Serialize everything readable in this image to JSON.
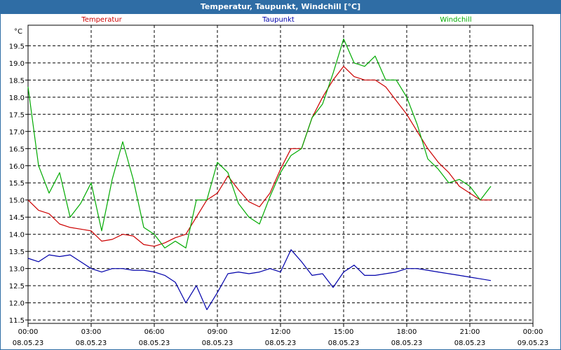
{
  "window": {
    "title": "Temperatur, Taupunkt, Windchill [°C]"
  },
  "chart_data": {
    "type": "line",
    "title": "Temperatur, Taupunkt, Windchill [°C]",
    "ylabel": "°C",
    "xlabel": "",
    "ylim": [
      11.4,
      20.1
    ],
    "y_ticks": [
      "11.5",
      "12.0",
      "12.5",
      "13.0",
      "13.5",
      "14.0",
      "14.5",
      "15.0",
      "15.5",
      "16.0",
      "16.5",
      "17.0",
      "17.5",
      "18.0",
      "18.5",
      "19.0",
      "19.5"
    ],
    "x_ticks": [
      {
        "time": "00:00",
        "date": "08.05.23"
      },
      {
        "time": "03:00",
        "date": "08.05.23"
      },
      {
        "time": "06:00",
        "date": "08.05.23"
      },
      {
        "time": "09:00",
        "date": "08.05.23"
      },
      {
        "time": "12:00",
        "date": "08.05.23"
      },
      {
        "time": "15:00",
        "date": "08.05.23"
      },
      {
        "time": "18:00",
        "date": "08.05.23"
      },
      {
        "time": "21:00",
        "date": "08.05.23"
      },
      {
        "time": "00:00",
        "date": "09.05.23"
      }
    ],
    "grid": true,
    "x": [
      0,
      0.5,
      1,
      1.5,
      2,
      2.5,
      3,
      3.5,
      4,
      4.5,
      5,
      5.5,
      6,
      6.5,
      7,
      7.5,
      8,
      8.5,
      9,
      9.5,
      10,
      10.5,
      11,
      11.5,
      12,
      12.5,
      13,
      13.5,
      14,
      14.5,
      15,
      15.5,
      16,
      16.5,
      17,
      17.5,
      18,
      18.5,
      19,
      19.5,
      20,
      20.5,
      21,
      21.5,
      22,
      22.5,
      23,
      23.5,
      24
    ],
    "series": [
      {
        "name": "Temperatur",
        "color": "#cc0000",
        "values": [
          15.0,
          14.7,
          14.6,
          14.3,
          14.2,
          14.15,
          14.1,
          13.8,
          13.85,
          14.0,
          13.95,
          13.7,
          13.65,
          13.75,
          13.9,
          14.0,
          14.5,
          15.0,
          15.2,
          15.7,
          15.3,
          14.95,
          14.8,
          15.2,
          15.9,
          16.5,
          16.5,
          17.4,
          18.0,
          18.5,
          18.9,
          18.6,
          18.5,
          18.5,
          18.3,
          17.9,
          17.5,
          17.0,
          16.5,
          16.1,
          15.8,
          15.4,
          15.2,
          15.0,
          15.0,
          null,
          null,
          null,
          null
        ]
      },
      {
        "name": "Taupunkt",
        "color": "#0000aa",
        "values": [
          13.3,
          13.2,
          13.4,
          13.35,
          13.4,
          13.2,
          13.0,
          12.9,
          13.0,
          13.0,
          12.95,
          12.95,
          12.9,
          12.8,
          12.6,
          12.0,
          12.5,
          11.8,
          12.3,
          12.85,
          12.9,
          12.85,
          12.9,
          13.0,
          12.9,
          13.55,
          13.2,
          12.8,
          12.85,
          12.45,
          12.9,
          13.1,
          12.8,
          12.8,
          12.85,
          12.9,
          13.0,
          13.0,
          12.95,
          12.9,
          12.85,
          12.8,
          12.75,
          12.7,
          12.65,
          null,
          null,
          null,
          null
        ]
      },
      {
        "name": "Windchill",
        "color": "#00aa00",
        "values": [
          18.3,
          16.0,
          15.2,
          15.8,
          14.5,
          14.9,
          15.5,
          14.1,
          15.6,
          16.7,
          15.6,
          14.2,
          14.0,
          13.6,
          13.8,
          13.6,
          15.0,
          15.0,
          16.1,
          15.8,
          14.9,
          14.5,
          14.3,
          15.1,
          15.8,
          16.3,
          16.5,
          17.4,
          17.8,
          18.7,
          19.7,
          19.0,
          18.9,
          19.2,
          18.5,
          18.5,
          18.0,
          17.2,
          16.2,
          15.9,
          15.5,
          15.6,
          15.4,
          15.0,
          15.4,
          null,
          null,
          null,
          null
        ]
      }
    ]
  }
}
